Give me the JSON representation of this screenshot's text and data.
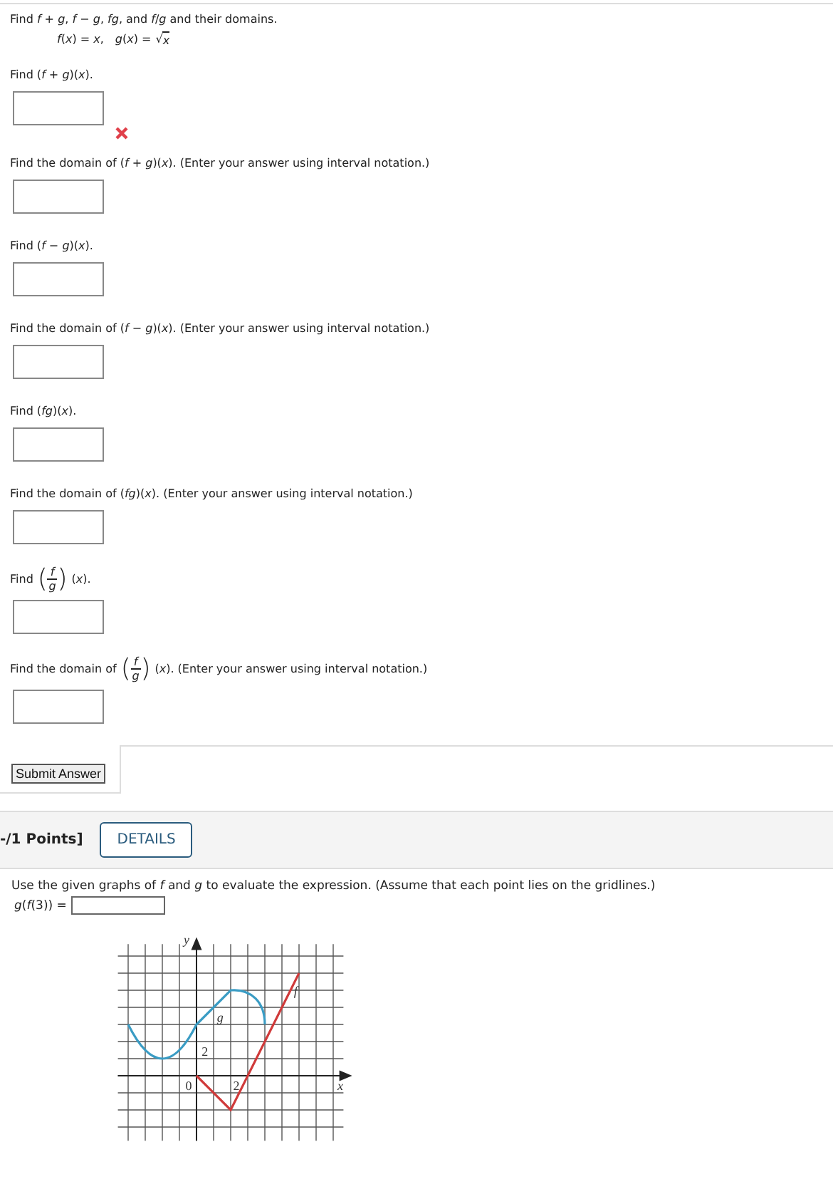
{
  "problem": {
    "intro": "Find *f* + *g*,  *f* − *g*,  *fg*,  and  *f*/*g*  and their domains.",
    "functions": {
      "f": "*f*(*x*) = *x*,",
      "g": "*g*(*x*) =",
      "radical_sign": "√",
      "radicand": "x"
    },
    "parts": [
      {
        "prompt": [
          {
            "kind": "text",
            "text": "Find  (*f* + *g*)(*x*)."
          }
        ],
        "incorrect": true
      },
      {
        "prompt": [
          {
            "kind": "text",
            "text": "Find the domain of  (*f* + *g*)(*x*).  (Enter your answer using interval notation.)"
          }
        ],
        "incorrect": false
      },
      {
        "prompt": [
          {
            "kind": "text",
            "text": "Find  (*f* − *g*)(*x*)."
          }
        ],
        "incorrect": false
      },
      {
        "prompt": [
          {
            "kind": "text",
            "text": "Find the domain of  (*f* − *g*)(*x*).  (Enter your answer using interval notation.)"
          }
        ],
        "incorrect": false
      },
      {
        "prompt": [
          {
            "kind": "text",
            "text": "Find  (*fg*)(*x*)."
          }
        ],
        "incorrect": false
      },
      {
        "prompt": [
          {
            "kind": "text",
            "text": "Find the domain of  (*fg*)(*x*).  (Enter your answer using interval notation.)"
          }
        ],
        "incorrect": false
      },
      {
        "prompt": [
          {
            "kind": "text",
            "text": "Find"
          },
          {
            "kind": "fraction",
            "open": "(",
            "num": "f",
            "den": "g",
            "close": ")"
          },
          {
            "kind": "text",
            "text": "(*x*)."
          }
        ],
        "incorrect": false
      },
      {
        "prompt": [
          {
            "kind": "text",
            "text": "Find the domain of"
          },
          {
            "kind": "fraction",
            "open": "(",
            "num": "f",
            "den": "g",
            "close": ")"
          },
          {
            "kind": "text",
            "text": "(*x*).  (Enter your answer using interval notation.)"
          }
        ],
        "incorrect": false
      }
    ],
    "submit": "Submit Answer"
  },
  "next": {
    "points": "-/1 Points]",
    "details": "DETAILS",
    "instruction": "Use the given graphs of *f* and *g* to evaluate the expression. (Assume that each point lies on the gridlines.)",
    "expression": "*g*(*f*(3)) =",
    "graph": {
      "y_label": "y",
      "x_label": "x",
      "origin": "0",
      "y_tick": "2",
      "x_tick": "2",
      "f_label": "f",
      "g_label": "g"
    }
  }
}
